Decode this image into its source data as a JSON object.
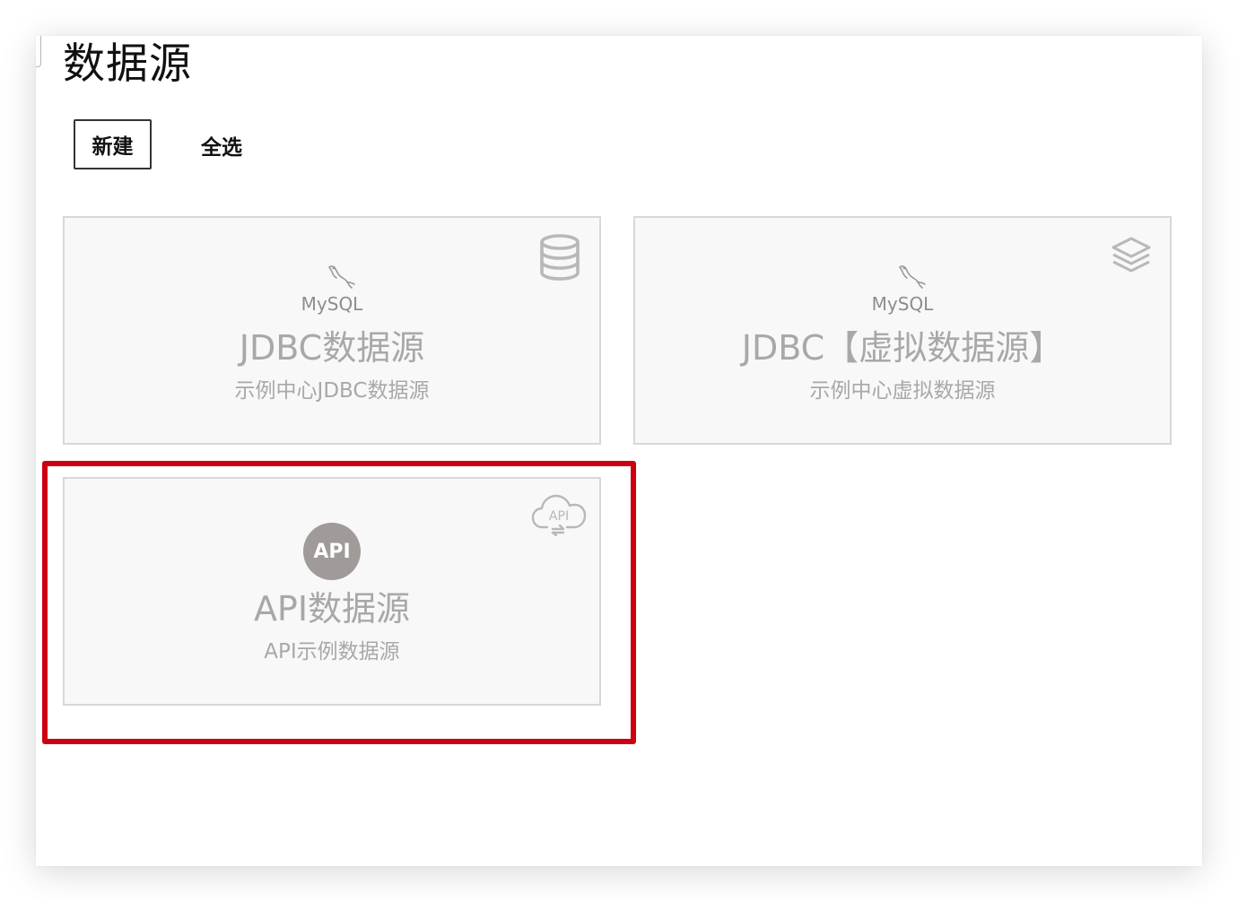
{
  "page": {
    "title": "数据源"
  },
  "toolbar": {
    "new_label": "新建",
    "select_all_label": "全选"
  },
  "cards": [
    {
      "logo_text": "MySQL",
      "logo_icon": "mysql-dolphin-icon",
      "type_icon": "database-icon",
      "title": "JDBC数据源",
      "subtitle": "示例中心JDBC数据源"
    },
    {
      "logo_text": "MySQL",
      "logo_icon": "mysql-dolphin-icon",
      "type_icon": "layers-icon",
      "title": "JDBC【虚拟数据源】",
      "subtitle": "示例中心虚拟数据源"
    },
    {
      "logo_text": "API",
      "logo_icon": "api-badge-icon",
      "type_icon": "cloud-api-icon",
      "title": "API数据源",
      "subtitle": "API示例数据源",
      "highlighted": true
    }
  ],
  "colors": {
    "highlight": "#cc0011",
    "card_background": "#f8f8f8",
    "card_border": "#d8d8d8",
    "muted_text": "#a8a8a8",
    "api_badge": "#a09a98"
  }
}
